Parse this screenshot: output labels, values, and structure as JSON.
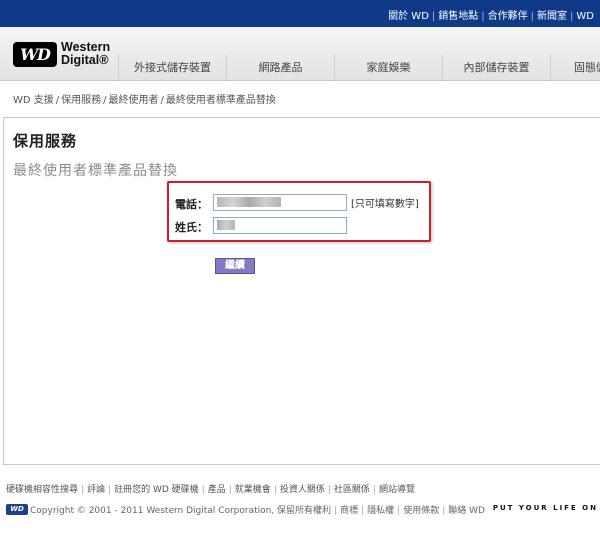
{
  "topbar": {
    "links": [
      "關於 WD",
      "銷售地點",
      "合作夥伴",
      "新聞室",
      "WD"
    ]
  },
  "logo": {
    "badge": "WD",
    "line1": "Western",
    "line2": "Digital®"
  },
  "nav": {
    "items": [
      "外接式儲存裝置",
      "網路產品",
      "家庭娛樂",
      "內部儲存裝置",
      "固態儲"
    ]
  },
  "breadcrumb": [
    "WD 支援",
    "保用服務",
    "最終使用者",
    "最終使用者標準產品替換"
  ],
  "page": {
    "title": "保用服務",
    "subtitle": "最終使用者標準產品替換"
  },
  "form": {
    "phone_label": "電話：",
    "phone_value": "",
    "phone_hint": "[只可填寫數字]",
    "name_label": "姓氏：",
    "name_value": "",
    "submit_label": "繼續"
  },
  "footer": {
    "links": [
      "硬碟機相容性搜尋",
      "評論",
      "註冊您的 WD 硬碟機",
      "產品",
      "就業機會",
      "投資人關係",
      "社區關係",
      "網站導覽"
    ],
    "wd_mini": "WD",
    "copyright": "Copyright © 2001 - 2011 Western Digital Corporation, 保留所有權利",
    "legal_links": [
      "商標",
      "隱私權",
      "使用條款",
      "聯絡 WD"
    ],
    "tagline": "PUT YOUR LIFE ON"
  },
  "colors": {
    "topbar": "#0f3a8a",
    "form_outline": "#c8202c",
    "submit": "#8579c2"
  }
}
